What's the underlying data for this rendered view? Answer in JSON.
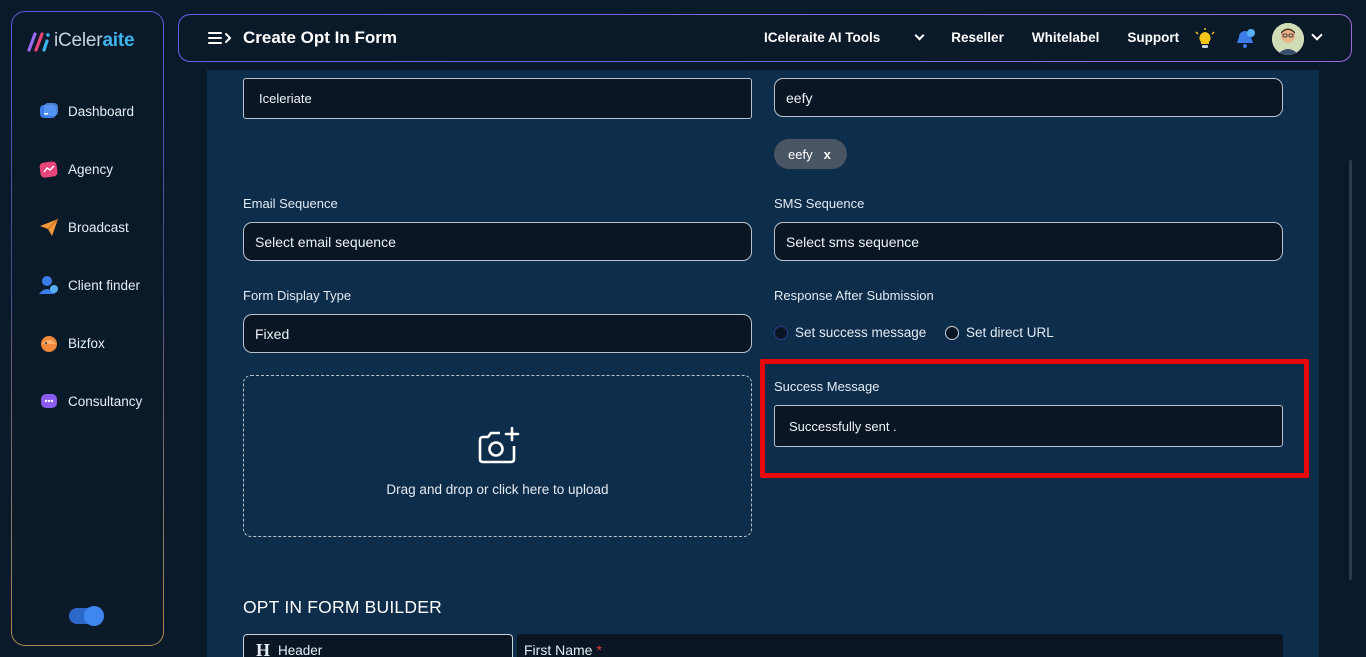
{
  "brand": {
    "part1": "iCeler",
    "part2": "aite"
  },
  "sidebar": {
    "items": [
      {
        "label": "Dashboard",
        "icon": "dashboard-icon",
        "color": "#3d7be8"
      },
      {
        "label": "Agency",
        "icon": "agency-icon",
        "color": "#e8457a"
      },
      {
        "label": "Broadcast",
        "icon": "broadcast-icon",
        "color": "#f09a3a"
      },
      {
        "label": "Client finder",
        "icon": "client-finder-icon",
        "color": "#3d7be8"
      },
      {
        "label": "Bizfox",
        "icon": "bizfox-icon",
        "color": "#f08a3a"
      },
      {
        "label": "Consultancy",
        "icon": "consultancy-icon",
        "color": "#8a5cf0"
      }
    ]
  },
  "header": {
    "title": "Create Opt In Form",
    "links": {
      "ai_tools": "ICeleraite AI Tools",
      "reseller": "Reseller",
      "whitelabel": "Whitelabel",
      "support": "Support"
    }
  },
  "form": {
    "name_value": "Iceleriate",
    "tag_input_value": "eefy",
    "tag_chip": "eefy",
    "tag_chip_remove": "x",
    "email_seq_label": "Email Sequence",
    "email_seq_value": "Select email sequence",
    "sms_seq_label": "SMS Sequence",
    "sms_seq_value": "Select sms sequence",
    "display_type_label": "Form Display Type",
    "display_type_value": "Fixed",
    "response_label": "Response After Submission",
    "radio_success": "Set success message",
    "radio_url": "Set direct URL",
    "upload_text": "Drag and drop or click here to upload",
    "success_label": "Success Message",
    "success_value": "Successfully sent ."
  },
  "builder": {
    "title": "OPT IN FORM BUILDER",
    "left_item_glyph": "H",
    "left_item_label": "Header",
    "right_field_label": "First Name",
    "required_mark": "*"
  },
  "colors": {
    "accent": "#3db4ef",
    "highlight": "#e8080c",
    "panel": "#0d2d4a"
  }
}
